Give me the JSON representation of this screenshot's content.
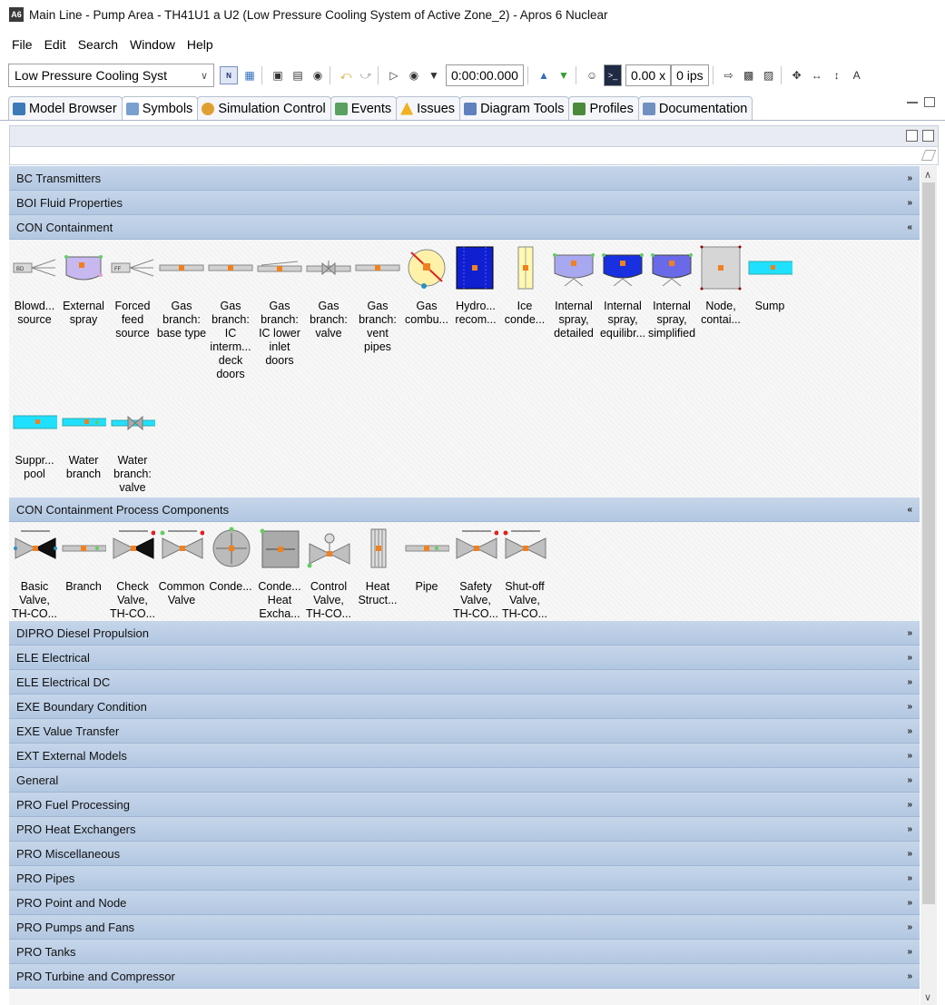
{
  "window": {
    "title": "Main Line - Pump Area - TH41U1 a U2 (Low Pressure Cooling System of Active Zone_2) - Apros 6 Nuclear",
    "app_badge": "A6"
  },
  "menu": [
    "File",
    "Edit",
    "Search",
    "Window",
    "Help"
  ],
  "toolbar": {
    "combo_value": "Low Pressure Cooling Syst",
    "time": "0:00:00.000",
    "speed": "0.00 x",
    "ips": "0 ips"
  },
  "tabs": [
    {
      "label": "Model Browser",
      "icon": "tree-icon",
      "color": "#3d7ab8"
    },
    {
      "label": "Symbols",
      "icon": "symbols-icon",
      "color": "#7aa0d0",
      "active": true
    },
    {
      "label": "Simulation Control",
      "icon": "sim-control-icon",
      "color": "#e0a030"
    },
    {
      "label": "Events",
      "icon": "events-icon",
      "color": "#5aa060"
    },
    {
      "label": "Issues",
      "icon": "warning-icon",
      "color": "#f0b020"
    },
    {
      "label": "Diagram Tools",
      "icon": "wrench-icon",
      "color": "#6080c0"
    },
    {
      "label": "Profiles",
      "icon": "profiles-icon",
      "color": "#4a8a3a"
    },
    {
      "label": "Documentation",
      "icon": "document-icon",
      "color": "#7090c0"
    }
  ],
  "categories_top": [
    {
      "label": "BC Transmitters",
      "state": "collapsed"
    },
    {
      "label": "BOI Fluid Properties",
      "state": "collapsed"
    }
  ],
  "con": {
    "label": "CON Containment",
    "row1": [
      {
        "label": "Blowd... source",
        "icon": "blowdown-source-icon"
      },
      {
        "label": "External spray",
        "icon": "external-spray-icon"
      },
      {
        "label": "Forced feed source",
        "icon": "forced-feed-source-icon"
      },
      {
        "label": "Gas branch: base type",
        "icon": "gas-branch-icon"
      },
      {
        "label": "Gas branch: IC interm... deck doors",
        "icon": "gas-branch-ic-icon"
      },
      {
        "label": "Gas branch: IC lower inlet doors",
        "icon": "gas-branch-lower-icon"
      },
      {
        "label": "Gas branch: valve",
        "icon": "gas-branch-valve-icon"
      },
      {
        "label": "Gas branch: vent pipes",
        "icon": "gas-branch-vent-icon"
      },
      {
        "label": "Gas combu...",
        "icon": "gas-combustion-icon"
      },
      {
        "label": "Hydro... recom...",
        "icon": "hydrogen-recombiner-icon"
      },
      {
        "label": "Ice conde...",
        "icon": "ice-condenser-icon"
      },
      {
        "label": "Internal spray, detailed",
        "icon": "internal-spray-detailed-icon"
      },
      {
        "label": "Internal spray, equilibr...",
        "icon": "internal-spray-equilibrium-icon"
      },
      {
        "label": "Internal spray, simplified",
        "icon": "internal-spray-simplified-icon"
      },
      {
        "label": "Node, contai...",
        "icon": "containment-node-icon"
      },
      {
        "label": "Sump",
        "icon": "sump-icon"
      }
    ],
    "row2": [
      {
        "label": "Suppr... pool",
        "icon": "suppression-pool-icon"
      },
      {
        "label": "Water branch",
        "icon": "water-branch-icon"
      },
      {
        "label": "Water branch: valve",
        "icon": "water-branch-valve-icon"
      }
    ]
  },
  "conpc": {
    "label": "CON Containment Process Components",
    "items": [
      {
        "label": "Basic Valve, TH-CO...",
        "icon": "basic-valve-icon"
      },
      {
        "label": "Branch",
        "icon": "branch-icon"
      },
      {
        "label": "Check Valve, TH-CO...",
        "icon": "check-valve-icon"
      },
      {
        "label": "Common Valve",
        "icon": "common-valve-icon"
      },
      {
        "label": "Conde...",
        "icon": "condenser-icon"
      },
      {
        "label": "Conde... Heat Excha...",
        "icon": "condenser-heat-exchanger-icon"
      },
      {
        "label": "Control Valve, TH-CO...",
        "icon": "control-valve-icon"
      },
      {
        "label": "Heat Struct...",
        "icon": "heat-structure-icon"
      },
      {
        "label": "Pipe",
        "icon": "pipe-icon"
      },
      {
        "label": "Safety Valve, TH-CO...",
        "icon": "safety-valve-icon"
      },
      {
        "label": "Shut-off Valve, TH-CO...",
        "icon": "shutoff-valve-icon"
      }
    ]
  },
  "categories_bottom": [
    "DIPRO Diesel Propulsion",
    "ELE Electrical",
    "ELE Electrical DC",
    "EXE Boundary Condition",
    "EXE Value Transfer",
    "EXT External Models",
    "General",
    "PRO Fuel Processing",
    "PRO Heat Exchangers",
    "PRO Miscellaneous",
    "PRO Pipes",
    "PRO Point and Node",
    "PRO Pumps and Fans",
    "PRO Tanks",
    "PRO Turbine and Compressor"
  ]
}
